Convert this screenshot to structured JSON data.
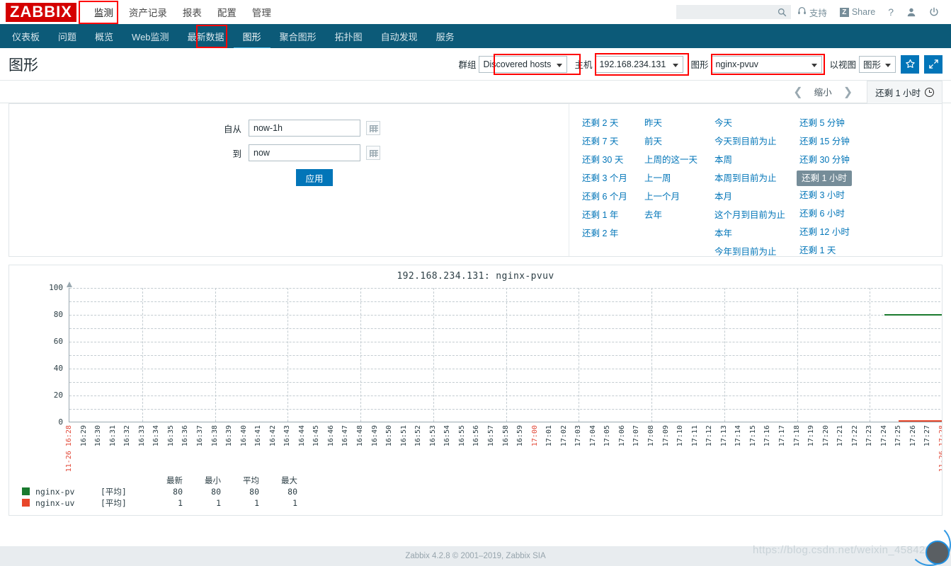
{
  "brand": {
    "logo": "ZABBIX"
  },
  "topmenu": {
    "items": [
      {
        "label": "监测",
        "selected": true
      },
      {
        "label": "资产记录",
        "selected": false
      },
      {
        "label": "报表",
        "selected": false
      },
      {
        "label": "配置",
        "selected": false
      },
      {
        "label": "管理",
        "selected": false
      }
    ]
  },
  "header": {
    "search_placeholder": "",
    "search_value": "",
    "support_label": "支持",
    "share_label": "Share",
    "share_badge": "Z",
    "help_label": "?",
    "user_icon": "user-icon",
    "signout_icon": "power-icon"
  },
  "subnav": {
    "items": [
      {
        "label": "仪表板",
        "selected": false
      },
      {
        "label": "问题",
        "selected": false
      },
      {
        "label": "概览",
        "selected": false
      },
      {
        "label": "Web监测",
        "selected": false
      },
      {
        "label": "最新数据",
        "selected": false
      },
      {
        "label": "图形",
        "selected": true
      },
      {
        "label": "聚合图形",
        "selected": false
      },
      {
        "label": "拓扑图",
        "selected": false
      },
      {
        "label": "自动发现",
        "selected": false
      },
      {
        "label": "服务",
        "selected": false
      }
    ]
  },
  "page": {
    "title": "图形",
    "filters": {
      "group_label": "群组",
      "group_value": "Discovered hosts",
      "host_label": "主机",
      "host_value": "192.168.234.131",
      "graph_label": "图形",
      "graph_value": "nginx-pvuv",
      "view_label": "以视图",
      "view_value": "图形"
    },
    "actions": {
      "favorite_icon": "star-icon",
      "fullscreen_icon": "expand-icon"
    }
  },
  "timenav": {
    "prev_icon": "chevron-left-icon",
    "zoom_out_label": "缩小",
    "next_icon": "chevron-right-icon",
    "range_label": "还剩 1 小时",
    "clock_icon": "clock-icon"
  },
  "timefilter": {
    "from_label": "自从",
    "from_value": "now-1h",
    "to_label": "到",
    "to_value": "now",
    "apply_label": "应用",
    "calendar_icon": "calendar-icon",
    "columns": [
      {
        "links": [
          {
            "label": "还剩 2 天",
            "active": false
          },
          {
            "label": "还剩 7 天",
            "active": false
          },
          {
            "label": "还剩 30 天",
            "active": false
          },
          {
            "label": "还剩 3 个月",
            "active": false
          },
          {
            "label": "还剩 6 个月",
            "active": false
          },
          {
            "label": "还剩 1 年",
            "active": false
          },
          {
            "label": "还剩 2 年",
            "active": false
          }
        ]
      },
      {
        "links": [
          {
            "label": "昨天",
            "active": false
          },
          {
            "label": "前天",
            "active": false
          },
          {
            "label": "上周的这一天",
            "active": false
          },
          {
            "label": "上一周",
            "active": false
          },
          {
            "label": "上一个月",
            "active": false
          },
          {
            "label": "去年",
            "active": false
          }
        ]
      },
      {
        "links": [
          {
            "label": "今天",
            "active": false
          },
          {
            "label": "今天到目前为止",
            "active": false
          },
          {
            "label": "本周",
            "active": false
          },
          {
            "label": "本周到目前为止",
            "active": false
          },
          {
            "label": "本月",
            "active": false
          },
          {
            "label": "这个月到目前为止",
            "active": false
          },
          {
            "label": "本年",
            "active": false
          },
          {
            "label": "今年到目前为止",
            "active": false
          }
        ]
      },
      {
        "links": [
          {
            "label": "还剩 5 分钟",
            "active": false
          },
          {
            "label": "还剩 15 分钟",
            "active": false
          },
          {
            "label": "还剩 30 分钟",
            "active": false
          },
          {
            "label": "还剩 1 小时",
            "active": true
          },
          {
            "label": "还剩 3 小时",
            "active": false
          },
          {
            "label": "还剩 6 小时",
            "active": false
          },
          {
            "label": "还剩 12 小时",
            "active": false
          },
          {
            "label": "还剩 1 天",
            "active": false
          }
        ]
      }
    ]
  },
  "chart_data": {
    "type": "line",
    "title": "192.168.234.131: nginx-pvuv",
    "xlabel": "",
    "ylabel": "",
    "ylim": [
      0,
      100
    ],
    "yticks": [
      0,
      20,
      40,
      60,
      80,
      100
    ],
    "grid": true,
    "legend_position": "bottom-left",
    "x_start_label": "11-26 16:28",
    "x_end_label": "11-26 17:28",
    "xtick_labels": [
      "16:28",
      "16:29",
      "16:30",
      "16:31",
      "16:32",
      "16:33",
      "16:34",
      "16:35",
      "16:36",
      "16:37",
      "16:38",
      "16:39",
      "16:40",
      "16:41",
      "16:42",
      "16:43",
      "16:44",
      "16:45",
      "16:46",
      "16:47",
      "16:48",
      "16:49",
      "16:50",
      "16:51",
      "16:52",
      "16:53",
      "16:54",
      "16:55",
      "16:56",
      "16:57",
      "16:58",
      "16:59",
      "17:00",
      "17:01",
      "17:02",
      "17:03",
      "17:04",
      "17:05",
      "17:06",
      "17:07",
      "17:08",
      "17:09",
      "17:10",
      "17:11",
      "17:12",
      "17:13",
      "17:14",
      "17:15",
      "17:16",
      "17:17",
      "17:18",
      "17:19",
      "17:20",
      "17:21",
      "17:22",
      "17:23",
      "17:24",
      "17:25",
      "17:26",
      "17:27",
      "17:28"
    ],
    "highlighted_xticks": [
      "17:00"
    ],
    "series": [
      {
        "name": "nginx-pv",
        "color": "#1a7a2e",
        "aggregation": "[平均]",
        "value": 80,
        "x_from": "17:24",
        "x_to": "17:28"
      },
      {
        "name": "nginx-uv",
        "color": "#e8462a",
        "aggregation": "[平均]",
        "value": 1,
        "x_from": "17:25",
        "x_to": "17:28"
      }
    ],
    "stats_headers": [
      "最新",
      "最小",
      "平均",
      "最大"
    ],
    "stats_rows": [
      {
        "name": "nginx-pv",
        "agg": "[平均]",
        "values": [
          "80",
          "80",
          "80",
          "80"
        ]
      },
      {
        "name": "nginx-uv",
        "agg": "[平均]",
        "values": [
          "1",
          "1",
          "1",
          "1"
        ]
      }
    ]
  },
  "footer": {
    "text": "Zabbix 4.2.8 © 2001–2019, Zabbix SIA"
  },
  "watermark": {
    "text": "https://blog.csdn.net/weixin_45842014"
  }
}
